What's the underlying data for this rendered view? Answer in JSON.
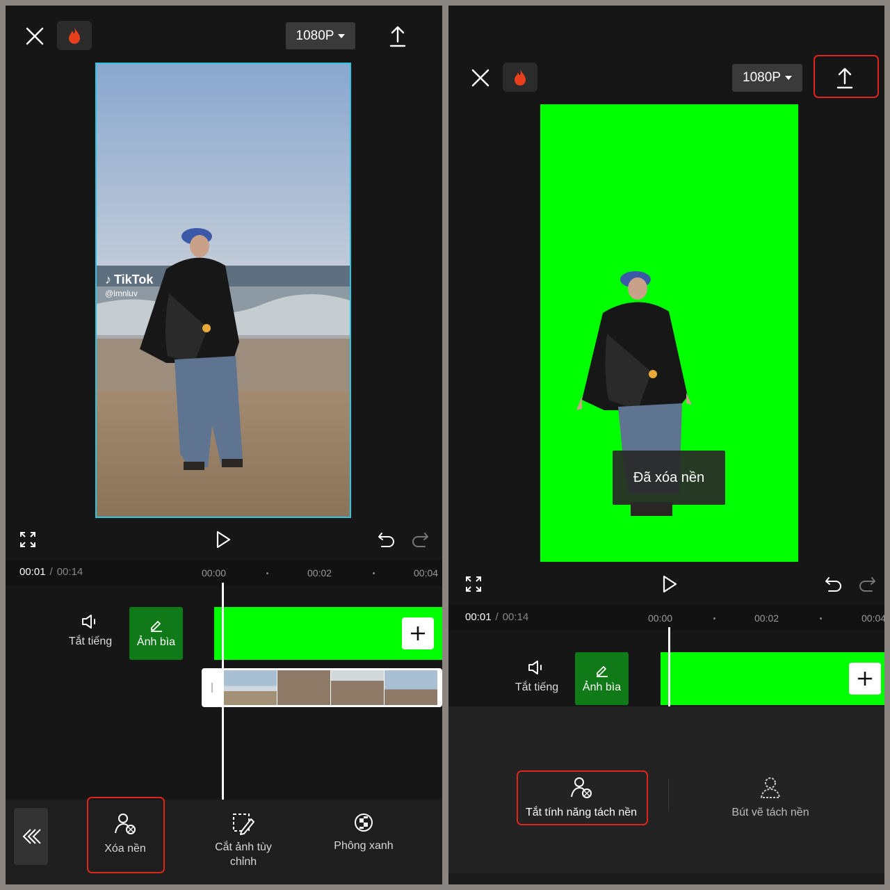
{
  "left": {
    "resolution": "1080P",
    "video": {
      "watermark_brand": "TikTok",
      "watermark_user": "@lmnluv"
    },
    "time": {
      "current": "00:01",
      "separator": "/",
      "total": "00:14"
    },
    "ticks": [
      "00:00",
      "00:02",
      "00:04"
    ],
    "mute_label": "Tắt tiếng",
    "cover_label": "Ảnh bìa",
    "toolbar": [
      {
        "icon": "person-erase-icon",
        "label": "Xóa nền"
      },
      {
        "icon": "crop-custom-icon",
        "label": "Cắt ảnh tùy chỉnh"
      },
      {
        "icon": "checker-ball-icon",
        "label": "Phông xanh"
      }
    ]
  },
  "right": {
    "resolution": "1080P",
    "toast": "Đã xóa nền",
    "time": {
      "current": "00:01",
      "separator": "/",
      "total": "00:14"
    },
    "ticks": [
      "00:00",
      "00:02",
      "00:04"
    ],
    "mute_label": "Tắt tiếng",
    "cover_label": "Ảnh bìa",
    "options": [
      {
        "icon": "person-erase-icon",
        "label": "Tắt tính năng tách nền"
      },
      {
        "icon": "person-outline-icon",
        "label": "Bút vẽ tách nền"
      }
    ]
  },
  "colors": {
    "highlight": "#e0251c",
    "green_screen": "#00ff00",
    "cover_green": "#0f7a17",
    "accent_flame": "#e8401c"
  }
}
